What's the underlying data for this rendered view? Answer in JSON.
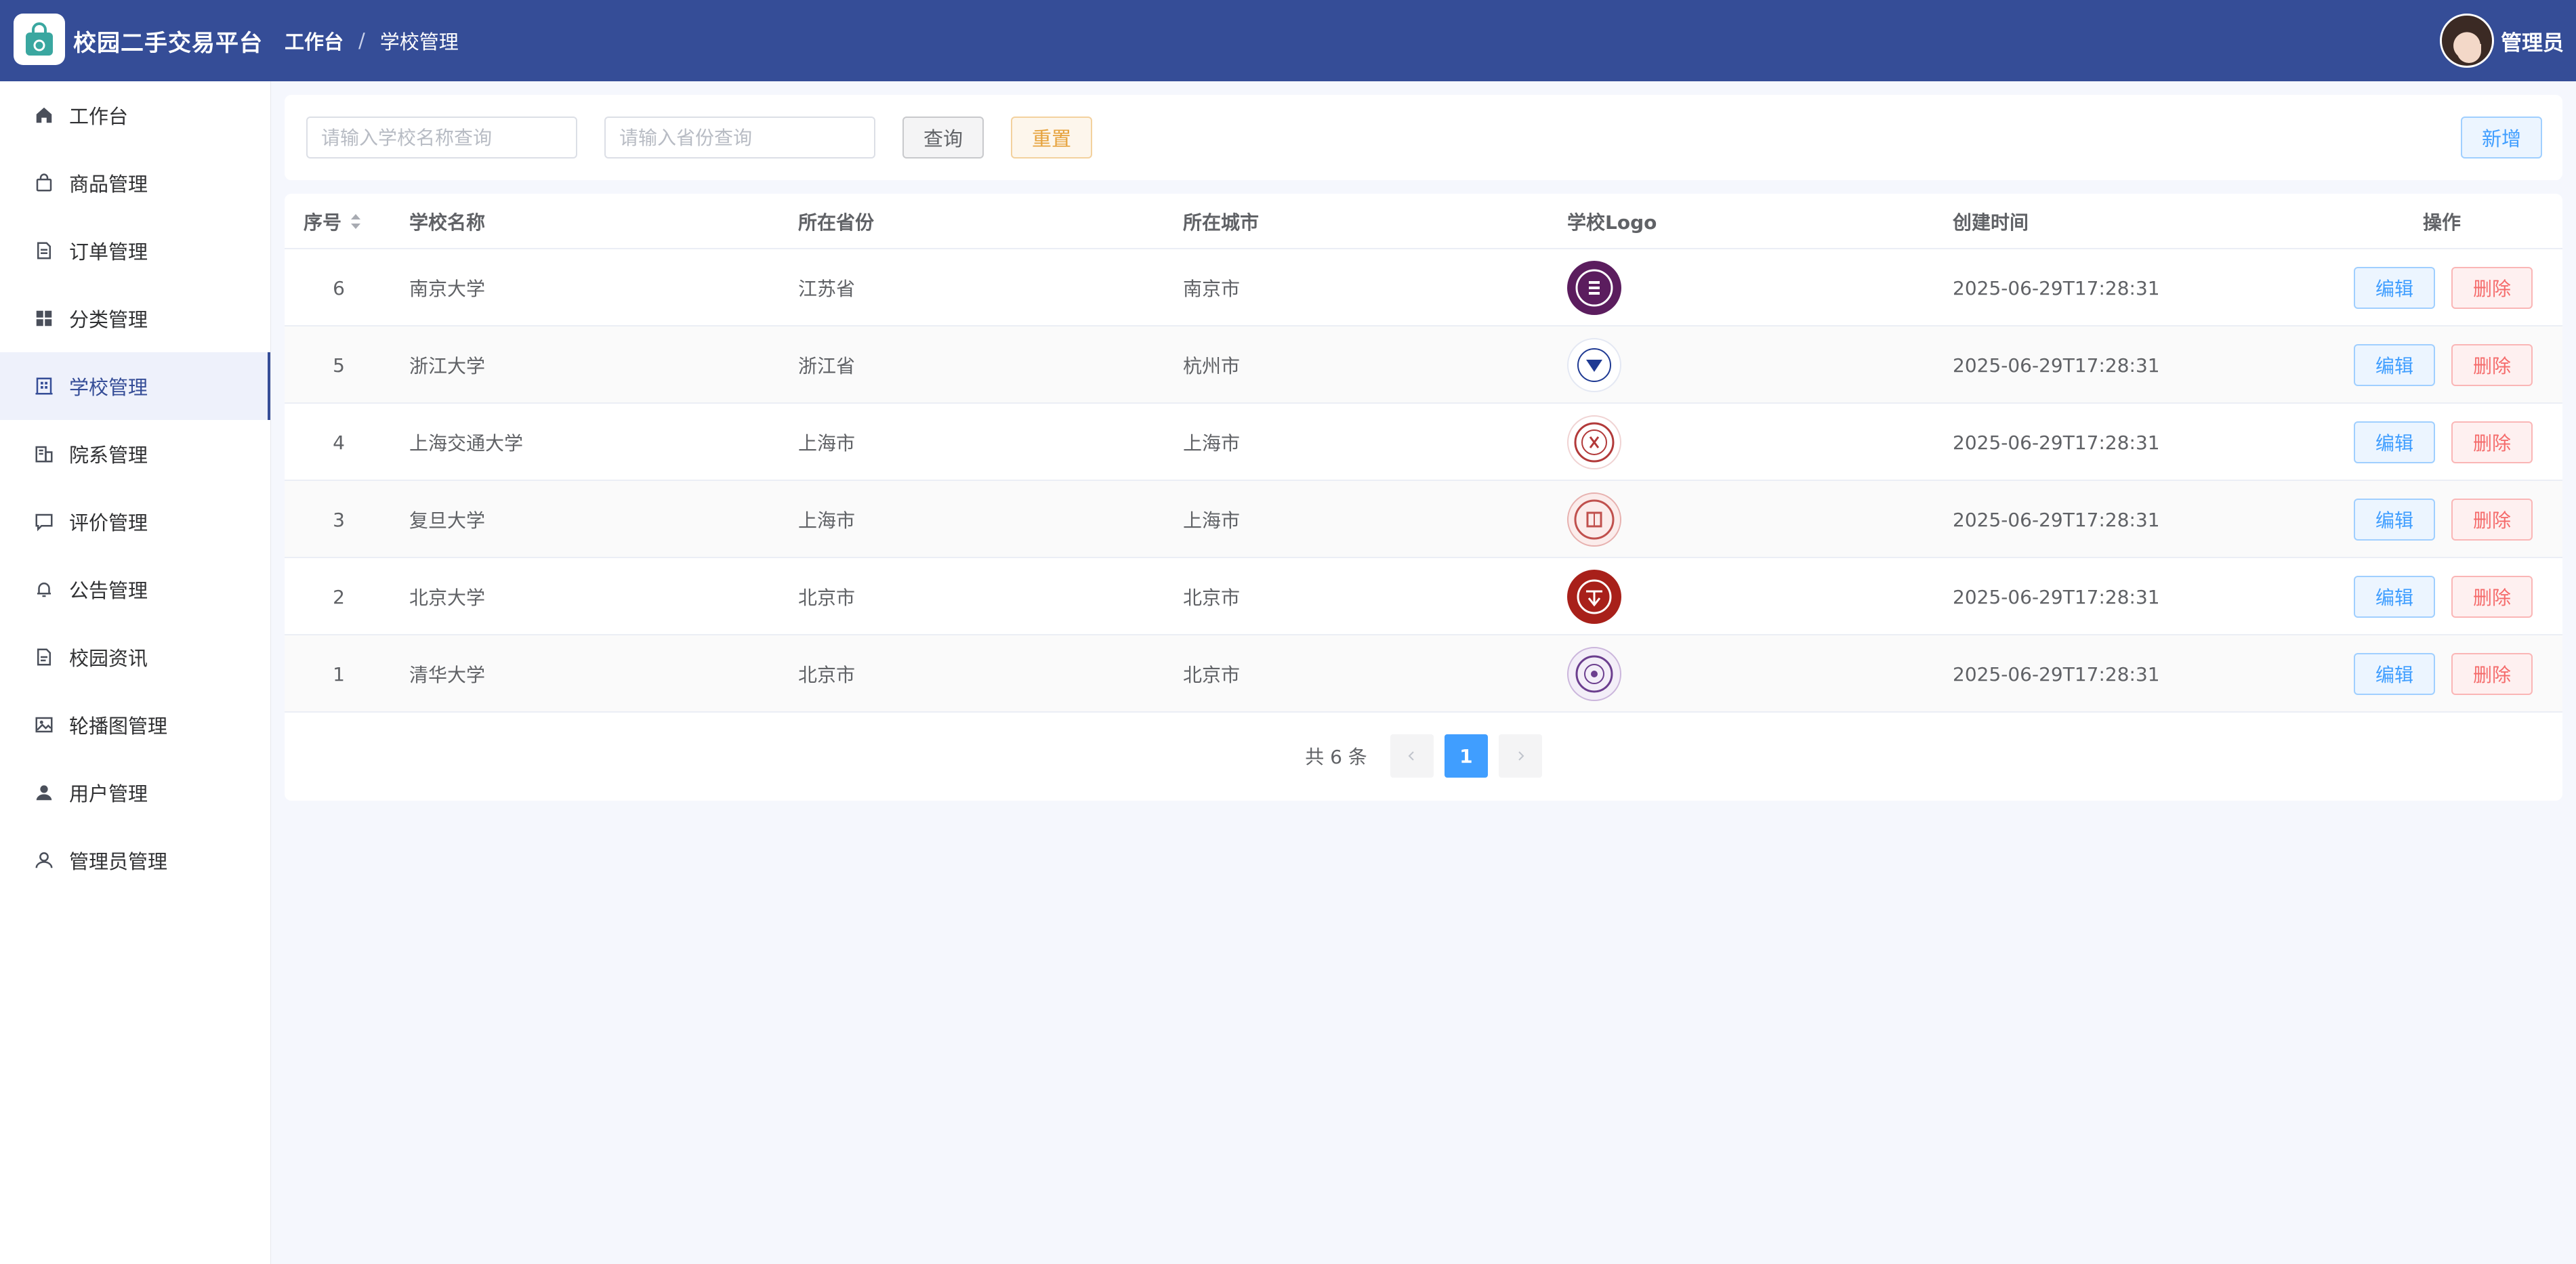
{
  "header": {
    "app_title": "校园二手交易平台",
    "breadcrumb": [
      "工作台",
      "学校管理"
    ],
    "breadcrumb_sep": "/",
    "user_name": "管理员"
  },
  "sidebar": {
    "items": [
      {
        "label": "工作台",
        "icon": "home-icon"
      },
      {
        "label": "商品管理",
        "icon": "shopping-bag-icon"
      },
      {
        "label": "订单管理",
        "icon": "document-icon"
      },
      {
        "label": "分类管理",
        "icon": "grid-icon"
      },
      {
        "label": "学校管理",
        "icon": "building-icon",
        "active": true
      },
      {
        "label": "院系管理",
        "icon": "office-icon"
      },
      {
        "label": "评价管理",
        "icon": "chat-icon"
      },
      {
        "label": "公告管理",
        "icon": "bell-icon"
      },
      {
        "label": "校园资讯",
        "icon": "news-icon"
      },
      {
        "label": "轮播图管理",
        "icon": "image-icon"
      },
      {
        "label": "用户管理",
        "icon": "user-filled-icon"
      },
      {
        "label": "管理员管理",
        "icon": "user-outline-icon"
      }
    ]
  },
  "search": {
    "school_placeholder": "请输入学校名称查询",
    "province_placeholder": "请输入省份查询",
    "query_label": "查询",
    "reset_label": "重置",
    "add_label": "新增"
  },
  "table": {
    "columns": [
      "序号",
      "学校名称",
      "所在省份",
      "所在城市",
      "学校Logo",
      "创建时间",
      "操作"
    ],
    "rows": [
      {
        "id": "6",
        "name": "南京大学",
        "province": "江苏省",
        "city": "南京市",
        "created": "2025-06-29T17:28:31",
        "logo_color": "#5b1d5e"
      },
      {
        "id": "5",
        "name": "浙江大学",
        "province": "浙江省",
        "city": "杭州市",
        "created": "2025-06-29T17:28:31",
        "logo_color": "#1f3a93"
      },
      {
        "id": "4",
        "name": "上海交通大学",
        "province": "上海市",
        "city": "上海市",
        "created": "2025-06-29T17:28:31",
        "logo_color": "#b23a3a"
      },
      {
        "id": "3",
        "name": "复旦大学",
        "province": "上海市",
        "city": "上海市",
        "created": "2025-06-29T17:28:31",
        "logo_color": "#c0504d"
      },
      {
        "id": "2",
        "name": "北京大学",
        "province": "北京市",
        "city": "北京市",
        "created": "2025-06-29T17:28:31",
        "logo_color": "#a8201a"
      },
      {
        "id": "1",
        "name": "清华大学",
        "province": "北京市",
        "city": "北京市",
        "created": "2025-06-29T17:28:31",
        "logo_color": "#6b3e8e"
      }
    ],
    "edit_label": "编辑",
    "delete_label": "删除"
  },
  "pagination": {
    "total_text": "共 6 条",
    "current_page": "1"
  },
  "colors": {
    "header_bg": "#354d97",
    "primary": "#409eff",
    "danger": "#f56c6c",
    "warning": "#e6a23c"
  }
}
